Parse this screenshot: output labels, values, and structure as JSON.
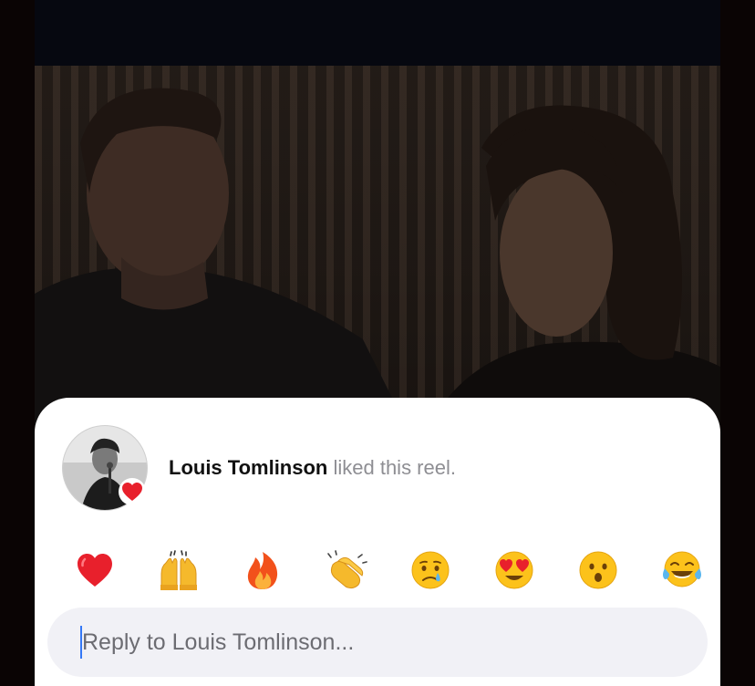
{
  "notification": {
    "username": "Louis Tomlinson",
    "action_text": " liked this reel."
  },
  "reactions": [
    {
      "name": "heart",
      "glyph": "❤️"
    },
    {
      "name": "raising-hands",
      "glyph": "🙌"
    },
    {
      "name": "fire",
      "glyph": "🔥"
    },
    {
      "name": "clapping-hands",
      "glyph": "👏"
    },
    {
      "name": "crying-face",
      "glyph": "😢"
    },
    {
      "name": "heart-eyes",
      "glyph": "😍"
    },
    {
      "name": "surprised-face",
      "glyph": "😮"
    },
    {
      "name": "tears-of-joy",
      "glyph": "😂"
    }
  ],
  "reply": {
    "placeholder": "Reply to Louis Tomlinson..."
  },
  "colors": {
    "heart": "#e8202c",
    "accent": "#3478f6"
  }
}
